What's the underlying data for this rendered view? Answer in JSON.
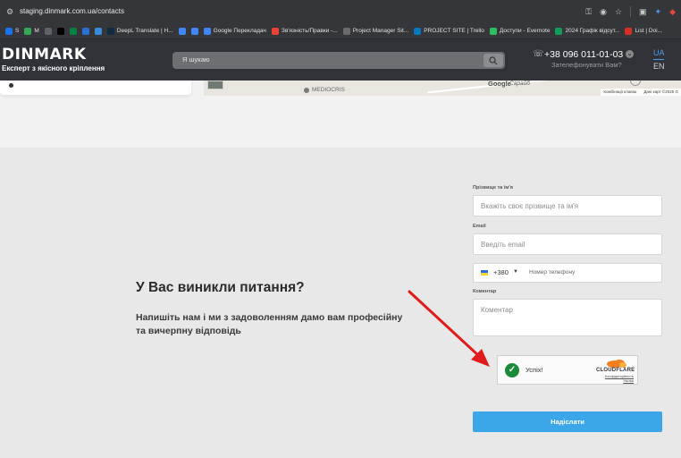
{
  "browser": {
    "url": "staging.dinmark.com.ua/contacts",
    "bookmarks": [
      {
        "label": "S",
        "color": "#1a73e8"
      },
      {
        "label": "M",
        "color": "#34a853"
      },
      {
        "label": "",
        "color": "#5f6368"
      },
      {
        "label": "",
        "color": "#000000"
      },
      {
        "label": "",
        "color": "#0b8043"
      },
      {
        "label": "",
        "color": "#2a6fd4"
      },
      {
        "label": "",
        "color": "#3a8be0"
      },
      {
        "label": "DeepL Translate | Н...",
        "color": "#0f2b46"
      },
      {
        "label": "",
        "color": "#4285f4"
      },
      {
        "label": "",
        "color": "#4285f4"
      },
      {
        "label": "Google Перекладач",
        "color": "#4285f4"
      },
      {
        "label": "Зв'язність/Правки -...",
        "color": "#ea4335"
      },
      {
        "label": "Project Manager Sit...",
        "color": "#6b6b6b"
      },
      {
        "label": "PROJECT SITE | Trello",
        "color": "#0079bf"
      },
      {
        "label": "Доступи - Evernote",
        "color": "#2dbe60"
      },
      {
        "label": "2024 Графік відсут...",
        "color": "#0f9d58"
      },
      {
        "label": "List | Doi...",
        "color": "#d93025"
      }
    ]
  },
  "header": {
    "logo": "DINMARK",
    "tagline": "Експерт з якісного кріплення",
    "search_placeholder": "Я шукаю",
    "phone": "+38 096 011-01-03",
    "callback": "Зателефонувати Вам?",
    "lang_active": "UA",
    "lang_other": "EN"
  },
  "map": {
    "poi_label": "MEDIOCRIS",
    "street": "Сарайб",
    "google": "Google",
    "credits_keys": "Комбінації клавіш",
    "credits_data": "Дані карт ©2025 G"
  },
  "contact": {
    "heading": "У Вас виникли питання?",
    "subtext": "Напишіть нам і ми з задоволенням дамо вам професійну та вичерпну відповідь",
    "name_label": "Прізвище та ім'я",
    "name_placeholder": "Вкажіть своє прізвище та ім'я",
    "email_label": "Email",
    "email_placeholder": "Введіть email",
    "phone_code": "+380",
    "phone_placeholder": "Номер телефону",
    "comment_label": "Коментар",
    "comment_placeholder": "Коментар",
    "captcha_status": "Успіх!",
    "captcha_brand": "CLOUDFLARE",
    "captcha_privacy": "Конфіденційність",
    "captcha_terms": "Умови",
    "submit": "Надіслати"
  },
  "colors": {
    "header_bg": "#303238",
    "accent": "#3ba6e8",
    "success": "#1a8a3a",
    "arrow": "#e01b1b"
  }
}
